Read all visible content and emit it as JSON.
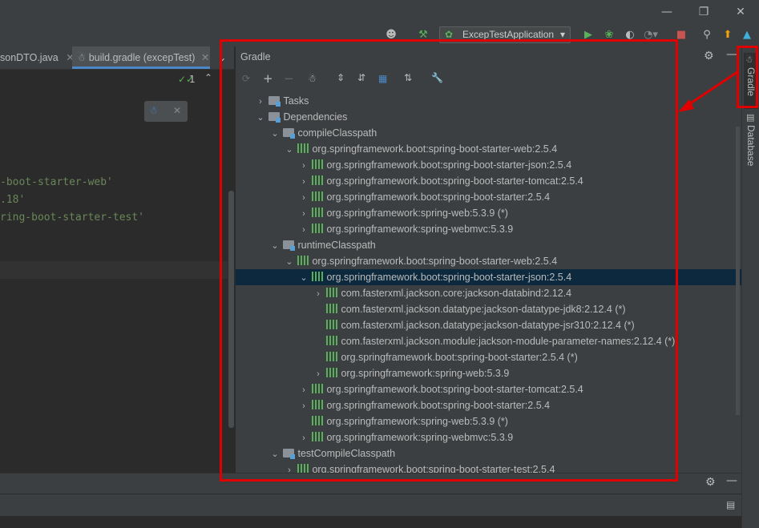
{
  "toolbar": {
    "run_config": "ExcepTestApplication",
    "icons": [
      "user-icon",
      "hammer-icon",
      "run-icon",
      "debug-icon",
      "coverage-icon",
      "profile-icon",
      "stop-icon",
      "search-icon",
      "update-icon",
      "toolbox-icon"
    ]
  },
  "editor": {
    "tabs": [
      {
        "label": "sonDTO.java"
      },
      {
        "label": "build.gradle (excepTest)"
      }
    ],
    "inspection_count": "1",
    "code_lines": [
      "-boot-starter-web'",
      ".18'",
      "ring-boot-starter-test'"
    ]
  },
  "gradle": {
    "title": "Gradle",
    "tree": [
      {
        "level": 0,
        "arrow": "right",
        "icon": "folder",
        "label": "Tasks"
      },
      {
        "level": 0,
        "arrow": "down",
        "icon": "folder",
        "label": "Dependencies"
      },
      {
        "level": 1,
        "arrow": "down",
        "icon": "folder",
        "label": "compileClasspath"
      },
      {
        "level": 2,
        "arrow": "down",
        "icon": "lib",
        "label": "org.springframework.boot:spring-boot-starter-web:2.5.4"
      },
      {
        "level": 3,
        "arrow": "right",
        "icon": "lib",
        "label": "org.springframework.boot:spring-boot-starter-json:2.5.4"
      },
      {
        "level": 3,
        "arrow": "right",
        "icon": "lib",
        "label": "org.springframework.boot:spring-boot-starter-tomcat:2.5.4"
      },
      {
        "level": 3,
        "arrow": "right",
        "icon": "lib",
        "label": "org.springframework.boot:spring-boot-starter:2.5.4"
      },
      {
        "level": 3,
        "arrow": "right",
        "icon": "lib",
        "label": "org.springframework:spring-web:5.3.9 (*)"
      },
      {
        "level": 3,
        "arrow": "right",
        "icon": "lib",
        "label": "org.springframework:spring-webmvc:5.3.9"
      },
      {
        "level": 1,
        "arrow": "down",
        "icon": "folder",
        "label": "runtimeClasspath"
      },
      {
        "level": 2,
        "arrow": "down",
        "icon": "lib",
        "label": "org.springframework.boot:spring-boot-starter-web:2.5.4"
      },
      {
        "level": 3,
        "arrow": "down",
        "icon": "lib",
        "label": "org.springframework.boot:spring-boot-starter-json:2.5.4",
        "selected": true
      },
      {
        "level": 4,
        "arrow": "right",
        "icon": "lib",
        "label": "com.fasterxml.jackson.core:jackson-databind:2.12.4"
      },
      {
        "level": 4,
        "arrow": "",
        "icon": "lib",
        "label": "com.fasterxml.jackson.datatype:jackson-datatype-jdk8:2.12.4 (*)"
      },
      {
        "level": 4,
        "arrow": "",
        "icon": "lib",
        "label": "com.fasterxml.jackson.datatype:jackson-datatype-jsr310:2.12.4 (*)"
      },
      {
        "level": 4,
        "arrow": "",
        "icon": "lib",
        "label": "com.fasterxml.jackson.module:jackson-module-parameter-names:2.12.4 (*)"
      },
      {
        "level": 4,
        "arrow": "",
        "icon": "lib",
        "label": "org.springframework.boot:spring-boot-starter:2.5.4 (*)"
      },
      {
        "level": 4,
        "arrow": "right",
        "icon": "lib",
        "label": "org.springframework:spring-web:5.3.9"
      },
      {
        "level": 3,
        "arrow": "right",
        "icon": "lib",
        "label": "org.springframework.boot:spring-boot-starter-tomcat:2.5.4"
      },
      {
        "level": 3,
        "arrow": "right",
        "icon": "lib",
        "label": "org.springframework.boot:spring-boot-starter:2.5.4"
      },
      {
        "level": 3,
        "arrow": "",
        "icon": "lib",
        "label": "org.springframework:spring-web:5.3.9 (*)"
      },
      {
        "level": 3,
        "arrow": "right",
        "icon": "lib",
        "label": "org.springframework:spring-webmvc:5.3.9"
      },
      {
        "level": 1,
        "arrow": "down",
        "icon": "folder",
        "label": "testCompileClasspath"
      },
      {
        "level": 2,
        "arrow": "right",
        "icon": "lib",
        "label": "org.springframework.boot:spring-boot-starter-test:2.5.4"
      }
    ]
  },
  "stripe": {
    "gradle_label": "Gradle",
    "database_label": "Database"
  },
  "colors": {
    "background": "#2b2b2b",
    "panel": "#3c3f41",
    "selection": "#0d293e",
    "annotation_red": "#e00000",
    "code_string": "#6a8759",
    "lib_icon": "#5aaf5a"
  }
}
